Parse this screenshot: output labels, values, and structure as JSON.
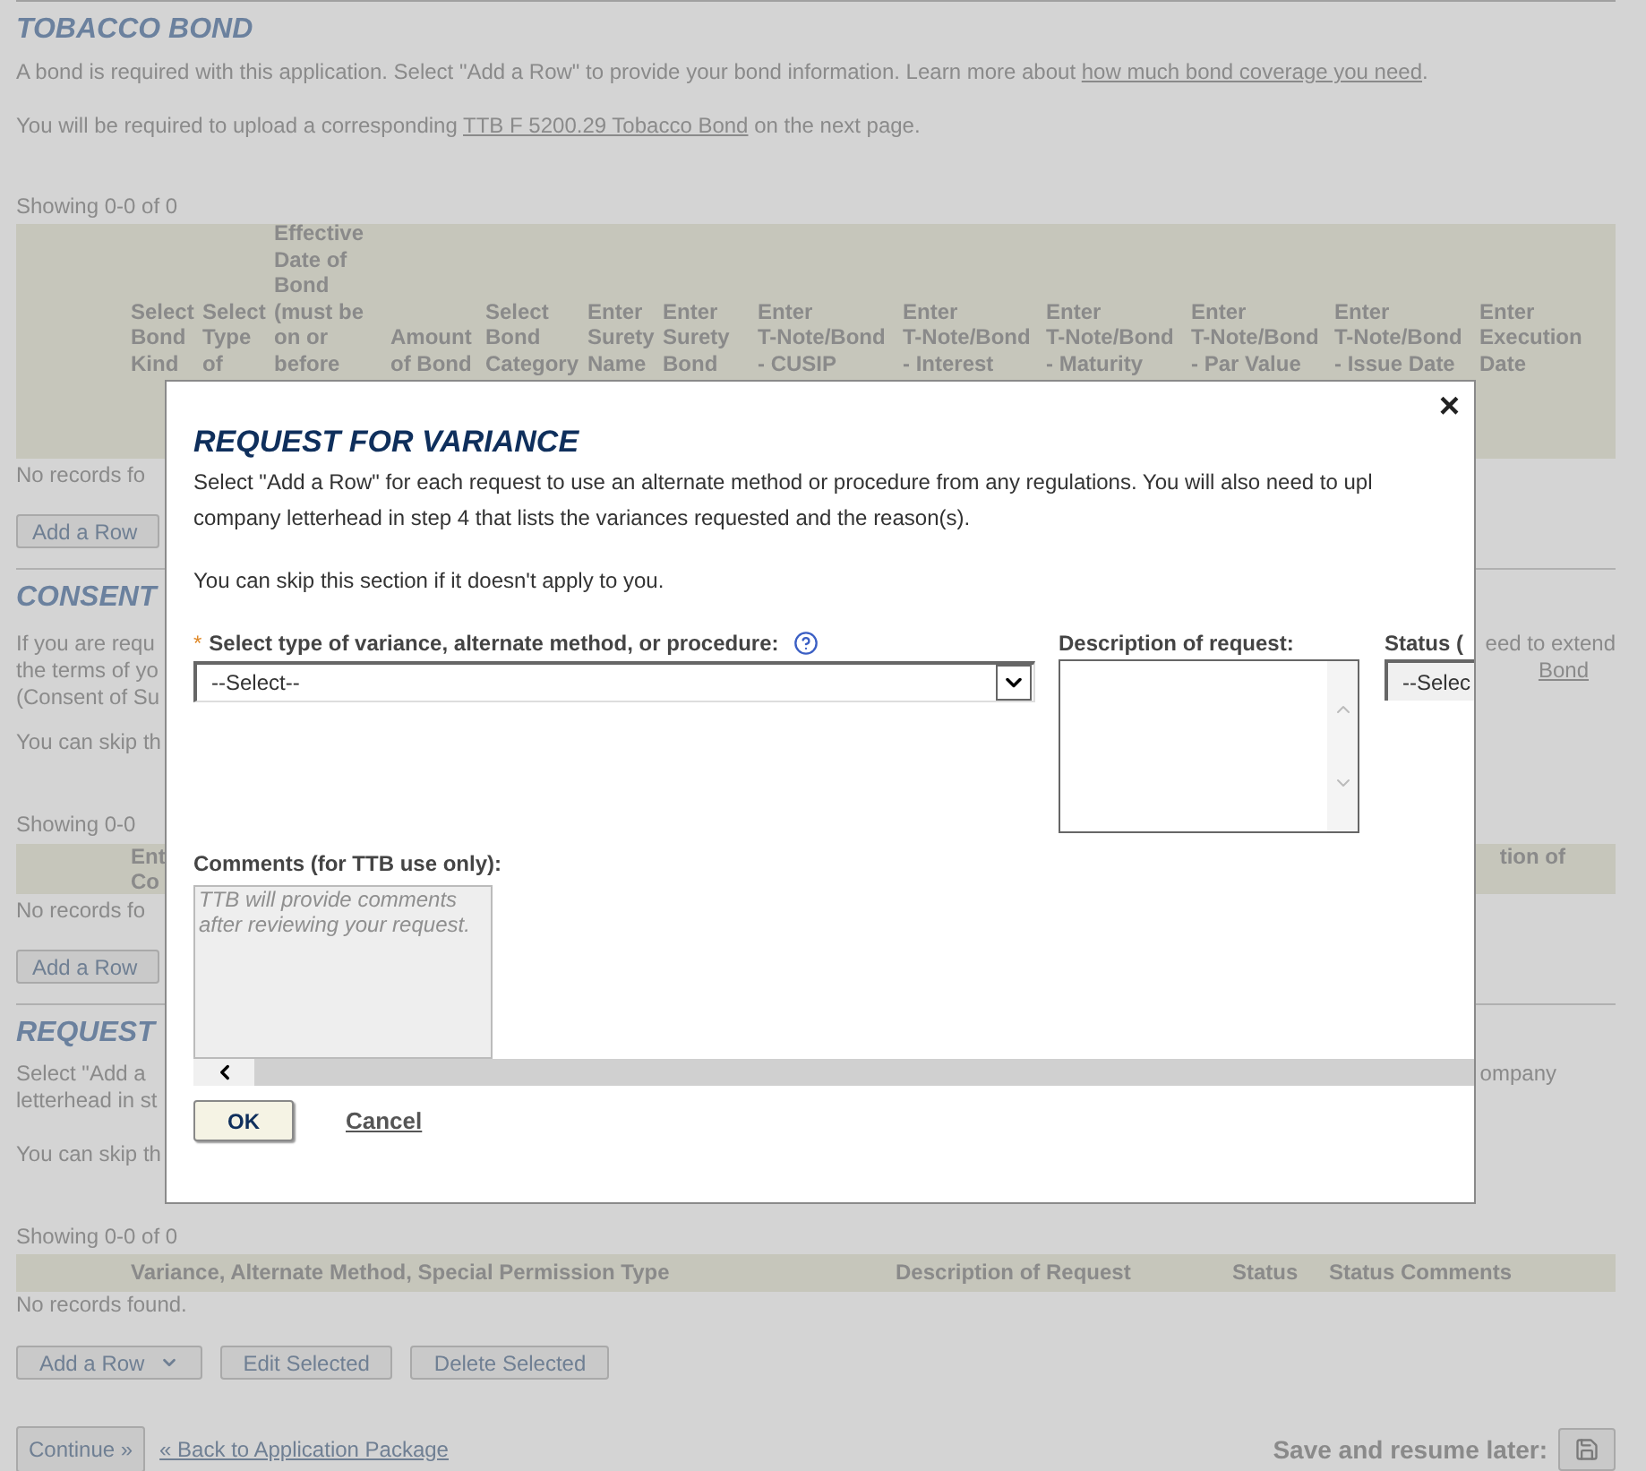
{
  "tobacco_bond": {
    "title": "TOBACCO BOND",
    "intro": {
      "before": "A bond is required with this application. Select \"Add a Row\" to provide your bond information. Learn more about ",
      "link": "how much bond coverage you need",
      "after": "."
    },
    "upload": {
      "before": "You will be required to upload a corresponding ",
      "link": "TTB F 5200.29 Tobacco Bond",
      "after": " on the next page."
    },
    "showing": "Showing 0-0 of 0",
    "columns": [
      "Select\nBond\nKind",
      "Select\nType\nof",
      "Effective\nDate of\nBond\n(must be\non or\nbefore",
      "Amount\nof Bond",
      "Select\nBond\nCategory",
      "Enter\nSurety\nName",
      "Enter\nSurety\nBond",
      "Enter\nT-Note/Bond\n- CUSIP",
      "Enter\nT-Note/Bond\n- Interest",
      "Enter\nT-Note/Bond\n- Maturity",
      "Enter\nT-Note/Bond\n- Par Value",
      "Enter\nT-Note/Bond\n- Issue Date",
      "Enter\nExecution\nDate"
    ],
    "empty": "No records fo",
    "add_row": "Add a Row"
  },
  "consent": {
    "title": "CONSENT",
    "lines": [
      {
        "left": "If you are requ",
        "right": {
          "text": "eed to extend",
          "link": false
        }
      },
      {
        "left": "the terms of yo",
        "right": {
          "text": "Bond",
          "link": true
        }
      },
      {
        "left": "(Consent of Su"
      }
    ],
    "skip": "You can skip th",
    "showing": "Showing 0-0",
    "column_left": "Ent\nCo",
    "column_right": "tion of",
    "empty": "No records fo",
    "add_row": "Add a Row"
  },
  "request": {
    "title": "REQUEST",
    "lines": [
      {
        "left": "Select \"Add a",
        "right": "ompany"
      },
      {
        "left": "letterhead in st"
      }
    ],
    "skip": "You can skip th",
    "showing": "Showing 0-0 of 0",
    "columns": [
      "Variance, Alternate Method, Special Permission Type",
      "Description of Request",
      "Status",
      "Status Comments"
    ],
    "empty": "No records found.",
    "buttons": [
      "Add a Row",
      "Edit Selected",
      "Delete Selected"
    ]
  },
  "footer": {
    "continue": "Continue »",
    "back": "« Back to Application Package",
    "save": "Save and resume later:"
  },
  "dialog": {
    "close": "×",
    "title": "REQUEST FOR VARIANCE",
    "lines": [
      "Select \"Add a Row\" for each request to use an alternate method or procedure from any regulations. You will also need to upl",
      "company letterhead in step 4 that lists the variances requested and the reason(s)."
    ],
    "skip": "You can skip this section if it doesn't apply to you.",
    "type_field": {
      "required": "*",
      "label": "Select type of variance, alternate method, or procedure:",
      "value": "--Select--"
    },
    "description_field": {
      "label": "Description of request:"
    },
    "status_field": {
      "label": "Status (",
      "value": "--Selec"
    },
    "comments_field": {
      "label": "Comments (for TTB use only):",
      "placeholder": "TTB will provide comments after reviewing your request.",
      "disabled": true
    },
    "ok": "OK",
    "cancel": "Cancel"
  }
}
